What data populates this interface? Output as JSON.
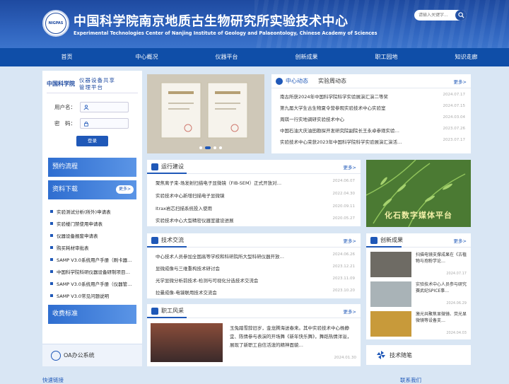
{
  "header": {
    "logo_text": "中国科学院南京地质古生物研究所",
    "title_cn": "中国科学院南京地质古生物研究所实验技术中心",
    "title_en": "Experimental Technologies Center of Nanjing Institute of Geology and Palaeontology, Chinese Academy of Sciences",
    "search_placeholder": "请输入关键字..."
  },
  "nav": [
    "首页",
    "中心概况",
    "仪器平台",
    "创新成果",
    "职工园地",
    "知识走廊"
  ],
  "login": {
    "brand": "中国科学院",
    "platform_title": "仪器设备共享管理平台",
    "user_label": "用户名：",
    "pwd_label": "密　码：",
    "button": "登录"
  },
  "side_banners": {
    "booking": "预约流程",
    "download": "资料下载",
    "download_more": "更多>",
    "fees": "收费标准"
  },
  "downloads": [
    "实验测试分析(所外)申请表",
    "实验楼门禁使用申请表",
    "仪器设备报废申请表",
    "购买耗材审批表",
    "SAMP V3.0系统用户手册（刷卡器…",
    "中国科学院科研仪器设备研制项目…",
    "SAMP V3.0系统用户手册（仪器管…",
    "SAMP V3.0常见问题说明"
  ],
  "oa_label": "OA办公系统",
  "news": {
    "tab_active": "中心动态",
    "tab_other": "实验周动态",
    "more": "更多>",
    "items": [
      {
        "title": "南古所获2024年中国科学院科学实验展演汇演二等奖",
        "date": "2024.07.17"
      },
      {
        "title": "第九届大学生古生物夏令营参观实验技术中心实验室",
        "date": "2024.07.15"
      },
      {
        "title": "周琪一行实地调研实验技术中心",
        "date": "2024.03.04"
      },
      {
        "title": "中国石油大庆油田勘探开发研究院副院长王永卓参观实验…",
        "date": "2023.07.26"
      },
      {
        "title": "实验技术中心荣获2023年中国科学院科学实验展演汇演活…",
        "date": "2023.07.17"
      }
    ]
  },
  "operation": {
    "title": "运行建设",
    "more": "更多>",
    "items": [
      {
        "title": "聚焦离子束-场发射扫描电子显微镜（FIB-SEM）正式开放对…",
        "date": "2024.06.07"
      },
      {
        "title": "实验技术中心新增扫描电子显微镜",
        "date": "2022.04.30"
      },
      {
        "title": "Itrax岩芯扫描系统投入使用",
        "date": "2020.09.11"
      },
      {
        "title": "实验技术中心大型精密仪器室建设进展",
        "date": "2020.05.27"
      }
    ]
  },
  "fossil_platform": "化石数字媒体平台",
  "tech": {
    "title": "技术交流",
    "more": "更多>",
    "items": [
      {
        "title": "中心技术人员参加全国高等学校和科研院所大型科研仪器开放…",
        "date": "2024.06.26"
      },
      {
        "title": "显微成像与三维重构技术研讨会",
        "date": "2023.12.21"
      },
      {
        "title": "光学显微分析前技术-检测与可视化分选技术交流会",
        "date": "2023.11.09"
      },
      {
        "title": "拉曼成像-电镜联用技术交流会",
        "date": "2023.10.20"
      }
    ]
  },
  "innovation": {
    "title": "创新成果",
    "more": "更多>",
    "items": [
      {
        "title": "扫描电镜支撑成果在《古植物与孢粉学论…",
        "date": "2024.07.17"
      },
      {
        "title": "实验技术中心人员参与研究赛武纪SPICE事…",
        "date": "2024.06.29"
      },
      {
        "title": "激光共聚焦显微镜、荧光显微镜等设备支…",
        "date": "2024.04.03"
      }
    ]
  },
  "staff": {
    "title": "职工风采",
    "more": "更多>",
    "text": "玉兔踏雪辞旧岁，金龙腾海送春来。其中实验技术中心杨静宜、陈倩参与表演的开场舞《新年快乐舞》，舞蹈热情洋溢，展现了新职工自信活泼的精神面貌…",
    "date": "2024.01.30"
  },
  "tech_notes": "技术随笔",
  "footer_left": "快速链接",
  "footer_right": "联系我们"
}
